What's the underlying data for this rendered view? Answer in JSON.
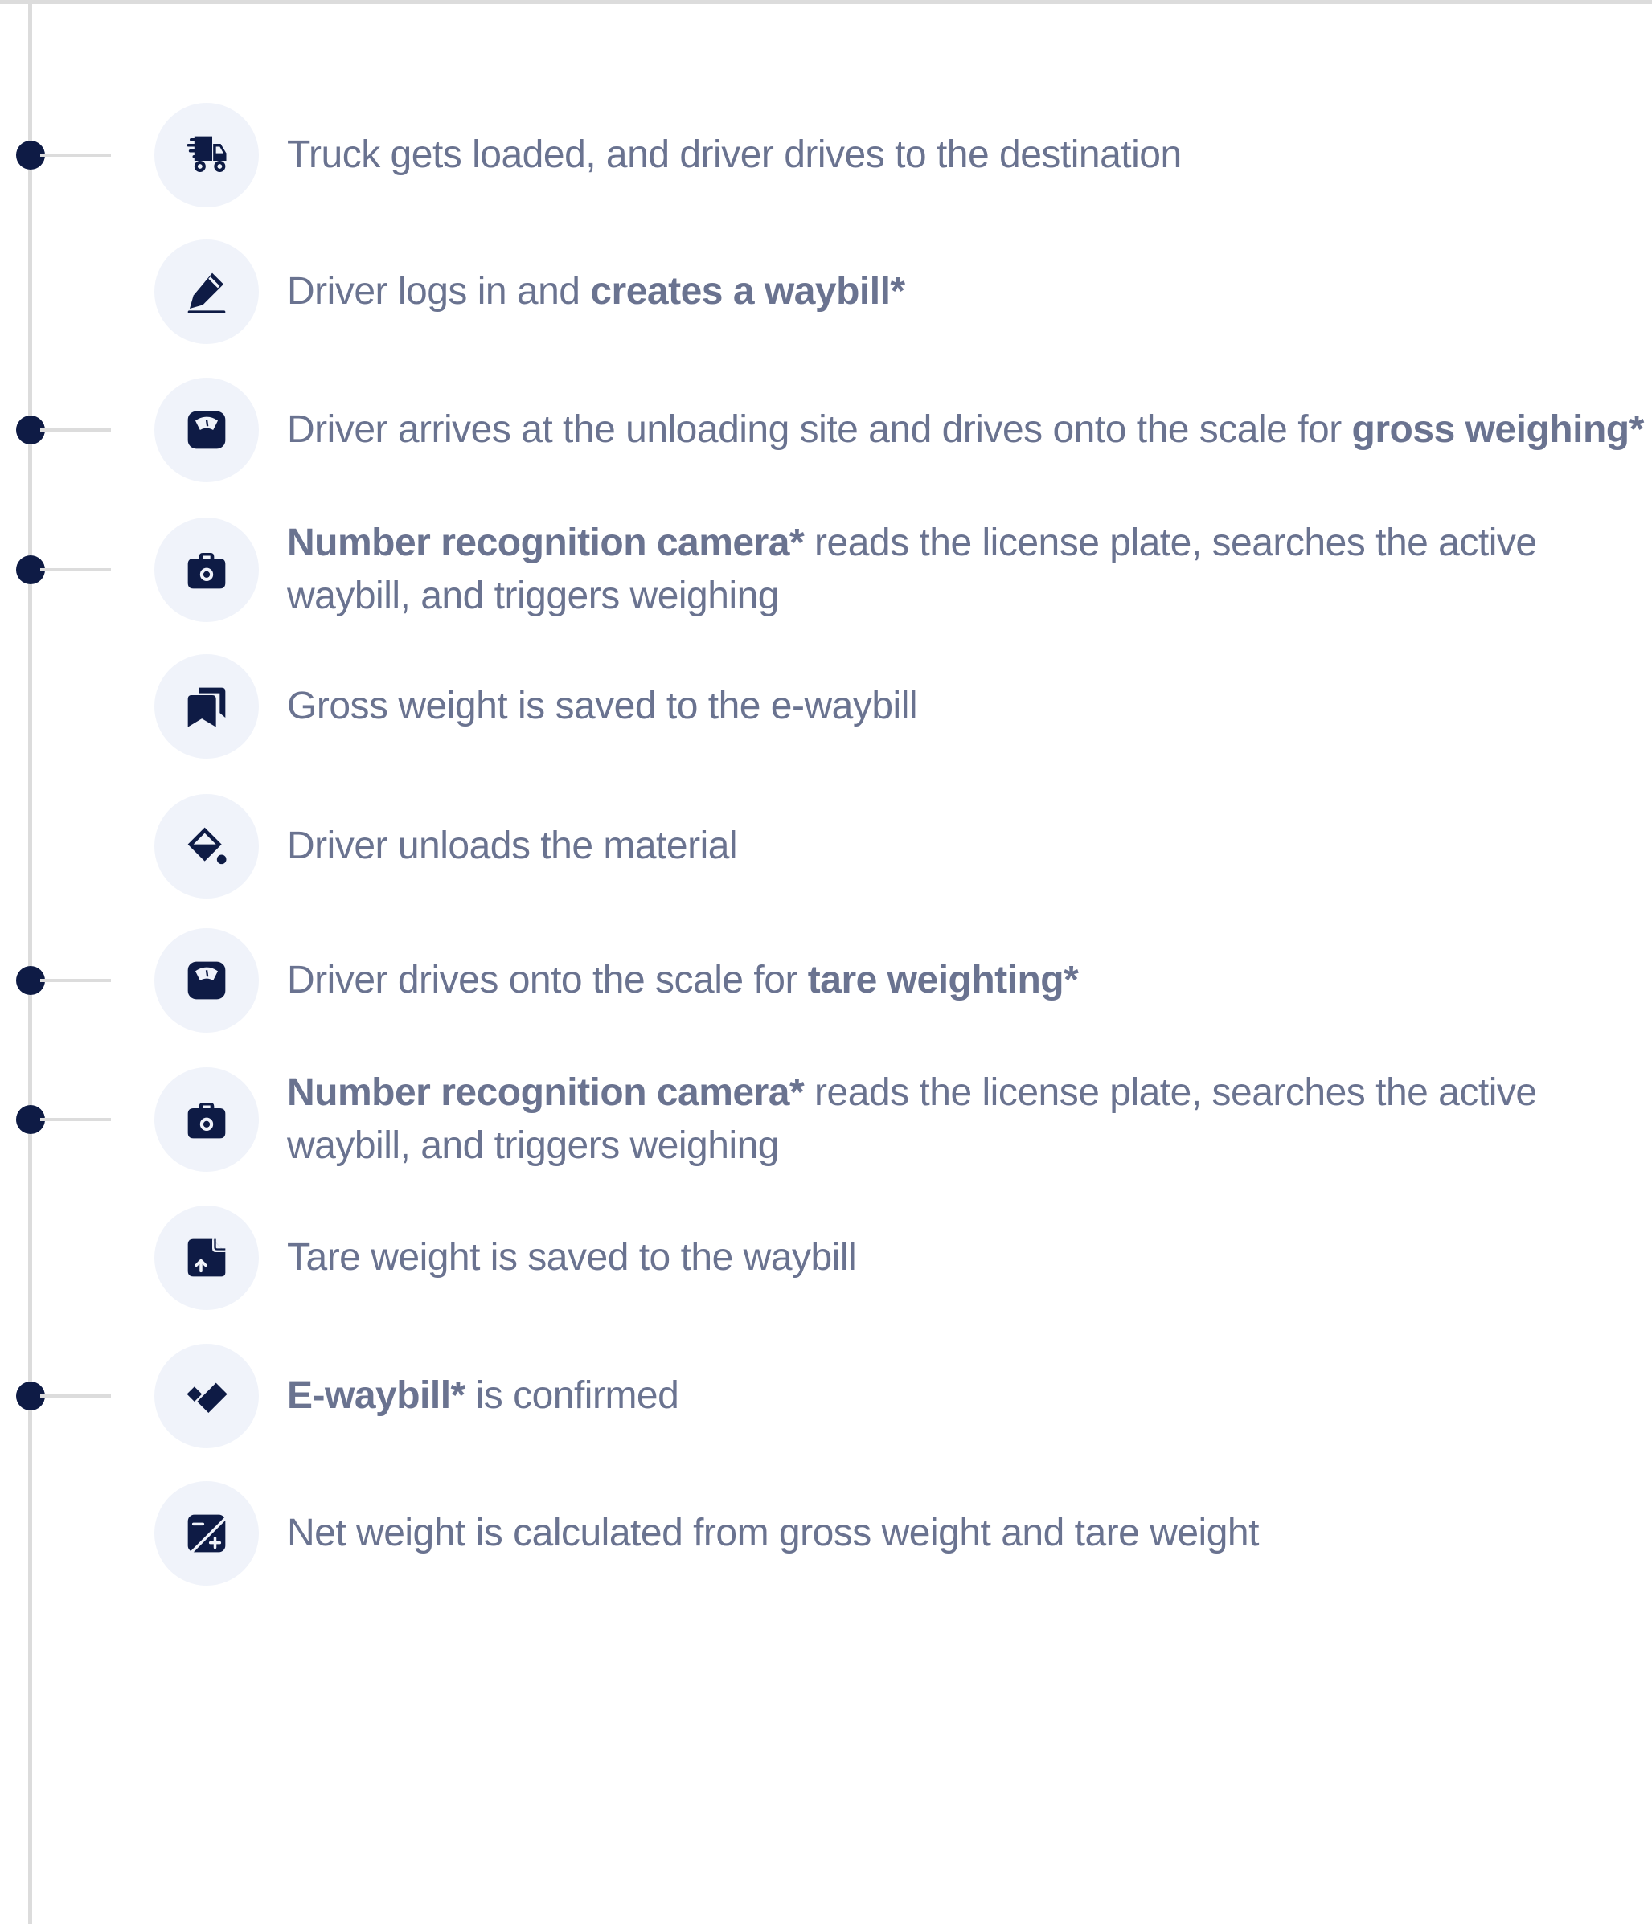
{
  "colors": {
    "marker": "#0e1b45",
    "icon": "#0e1b45",
    "icon_background": "#f0f3fa",
    "text": "#6a7390",
    "line": "#dcdcdc"
  },
  "steps": [
    {
      "icon": "truck-fast-icon",
      "has_marker": true,
      "parts": [
        {
          "text": "Truck gets loaded, and driver drives to the destination",
          "bold": false
        }
      ]
    },
    {
      "icon": "pen-edit-icon",
      "has_marker": false,
      "parts": [
        {
          "text": "Driver logs in and ",
          "bold": false
        },
        {
          "text": "creates a waybill*",
          "bold": true
        }
      ]
    },
    {
      "icon": "scale-icon",
      "has_marker": true,
      "parts": [
        {
          "text": "Driver arrives at the unloading site and drives onto the scale for ",
          "bold": false
        },
        {
          "text": "gross weighing*",
          "bold": true
        }
      ]
    },
    {
      "icon": "camera-icon",
      "has_marker": true,
      "parts": [
        {
          "text": "Number recognition camera*",
          "bold": true
        },
        {
          "text": " reads the license plate, searches the active waybill, and triggers weighing",
          "bold": false
        }
      ]
    },
    {
      "icon": "bookmarks-icon",
      "has_marker": false,
      "parts": [
        {
          "text": "Gross weight is saved to the e-waybill",
          "bold": false
        }
      ]
    },
    {
      "icon": "paint-bucket-icon",
      "has_marker": false,
      "parts": [
        {
          "text": "Driver unloads the material",
          "bold": false
        }
      ]
    },
    {
      "icon": "scale-icon",
      "has_marker": true,
      "parts": [
        {
          "text": "Driver drives onto the scale for ",
          "bold": false
        },
        {
          "text": "tare weighting*",
          "bold": true
        }
      ]
    },
    {
      "icon": "camera-icon",
      "has_marker": true,
      "parts": [
        {
          "text": "Number recognition camera*",
          "bold": true
        },
        {
          "text": " reads the license plate, searches the active waybill, and triggers weighing",
          "bold": false
        }
      ]
    },
    {
      "icon": "document-upload-icon",
      "has_marker": false,
      "parts": [
        {
          "text": "Tare weight is saved to the waybill",
          "bold": false
        }
      ]
    },
    {
      "icon": "double-check-icon",
      "has_marker": true,
      "parts": [
        {
          "text": "E-waybill*",
          "bold": true
        },
        {
          "text": " is confirmed",
          "bold": false
        }
      ]
    },
    {
      "icon": "calculator-icon",
      "has_marker": false,
      "parts": [
        {
          "text": "Net weight is calculated from gross weight and tare weight",
          "bold": false
        }
      ]
    }
  ]
}
